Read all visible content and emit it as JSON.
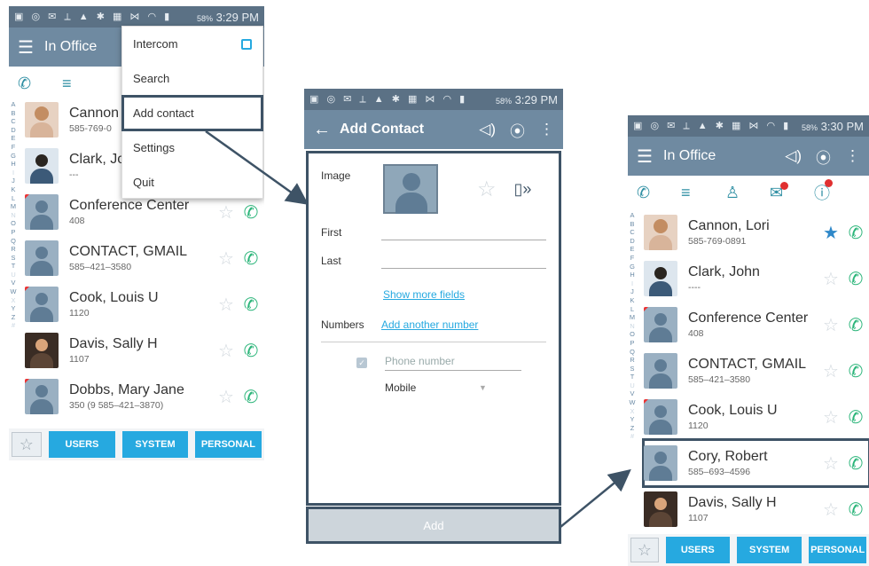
{
  "screen1": {
    "status": {
      "icons": "▣ ◎ ✉ ⟂ ▲ ✱ ▦ ⋈ ◠ ▮",
      "battery": "58%",
      "time": "3:29 PM"
    },
    "appbar_title": "In Office",
    "menu": [
      {
        "label": "Intercom"
      },
      {
        "label": "Search"
      },
      {
        "label": "Add contact"
      },
      {
        "label": "Settings"
      },
      {
        "label": "Quit"
      }
    ],
    "contacts": [
      {
        "name": "Cannon",
        "sub": "585-769-0"
      },
      {
        "name": "Clark, Jo",
        "sub": "---"
      },
      {
        "name": "Conference Center",
        "sub": "408"
      },
      {
        "name": "CONTACT, GMAIL",
        "sub": "585–421–3580"
      },
      {
        "name": "Cook, Louis U",
        "sub": "1120"
      },
      {
        "name": "Davis, Sally H",
        "sub": "1107"
      },
      {
        "name": "Dobbs, Mary Jane",
        "sub": "350 (9 585–421–3870)"
      }
    ],
    "buttons": {
      "users": "USERS",
      "system": "SYSTEM",
      "personal": "PERSONAL"
    }
  },
  "screen2": {
    "status": {
      "icons": "▣ ◎ ✉ ⟂ ▲ ✱ ▦ ⋈ ◠ ▮",
      "battery": "58%",
      "time": "3:29 PM"
    },
    "appbar_title": "Add Contact",
    "image_label": "Image",
    "first_label": "First",
    "last_label": "Last",
    "show_more": "Show more fields",
    "numbers_label": "Numbers",
    "add_number": "Add another number",
    "phone_placeholder": "Phone number",
    "phone_type": "Mobile",
    "add_button": "Add"
  },
  "screen3": {
    "status": {
      "icons": "▣ ◎ ✉ ⟂ ▲ ✱ ▦ ⋈ ◠ ▮",
      "battery": "58%",
      "time": "3:30 PM"
    },
    "appbar_title": "In Office",
    "contacts": [
      {
        "name": "Cannon, Lori",
        "sub": "585-769-0891"
      },
      {
        "name": "Clark, John",
        "sub": "----"
      },
      {
        "name": "Conference Center",
        "sub": "408"
      },
      {
        "name": "CONTACT, GMAIL",
        "sub": "585–421–3580"
      },
      {
        "name": "Cook, Louis U",
        "sub": "1120"
      },
      {
        "name": "Cory, Robert",
        "sub": "585–693–4596"
      },
      {
        "name": "Davis, Sally H",
        "sub": "1107"
      }
    ],
    "buttons": {
      "users": "USERS",
      "system": "SYSTEM",
      "personal": "PERSONAL"
    }
  },
  "alphabet": [
    "A",
    "B",
    "C",
    "D",
    "E",
    "F",
    "G",
    "H",
    "I",
    "J",
    "K",
    "L",
    "M",
    "N",
    "O",
    "P",
    "Q",
    "R",
    "S",
    "T",
    "U",
    "V",
    "W",
    "X",
    "Y",
    "Z",
    "#"
  ]
}
